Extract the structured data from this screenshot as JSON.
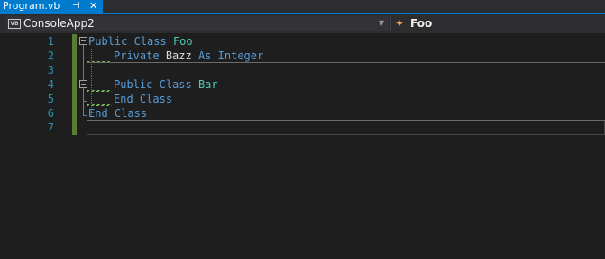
{
  "tab": {
    "title": "Program.vb",
    "pin_icon": "pin-icon",
    "close_icon": "close-icon"
  },
  "navbar": {
    "project": "ConsoleApp2",
    "project_icon_text": "VB",
    "dropdown_icon": "chevron-down-icon",
    "member": "Foo",
    "member_icon": "class-icon"
  },
  "editor": {
    "line_numbers": [
      "1",
      "2",
      "3",
      "4",
      "5",
      "6",
      "7"
    ],
    "lines": [
      {
        "kw1": "Public",
        "kw2": "Class",
        "name": "Foo"
      },
      {
        "kw1": "Private",
        "ident": "Bazz",
        "kw2": "As",
        "kw3": "Integer"
      },
      {},
      {
        "kw1": "Public",
        "kw2": "Class",
        "name": "Bar"
      },
      {
        "kw1": "End",
        "kw2": "Class"
      },
      {
        "kw1": "End",
        "kw2": "Class"
      },
      {}
    ]
  },
  "colors": {
    "tab_accent": "#007acc",
    "keyword": "#569cd6",
    "type_name": "#4ec9b0",
    "identifier": "#dcdcdc",
    "line_number": "#2b91af",
    "change_marker": "#5a7d34",
    "squiggle": "#7bb661"
  }
}
